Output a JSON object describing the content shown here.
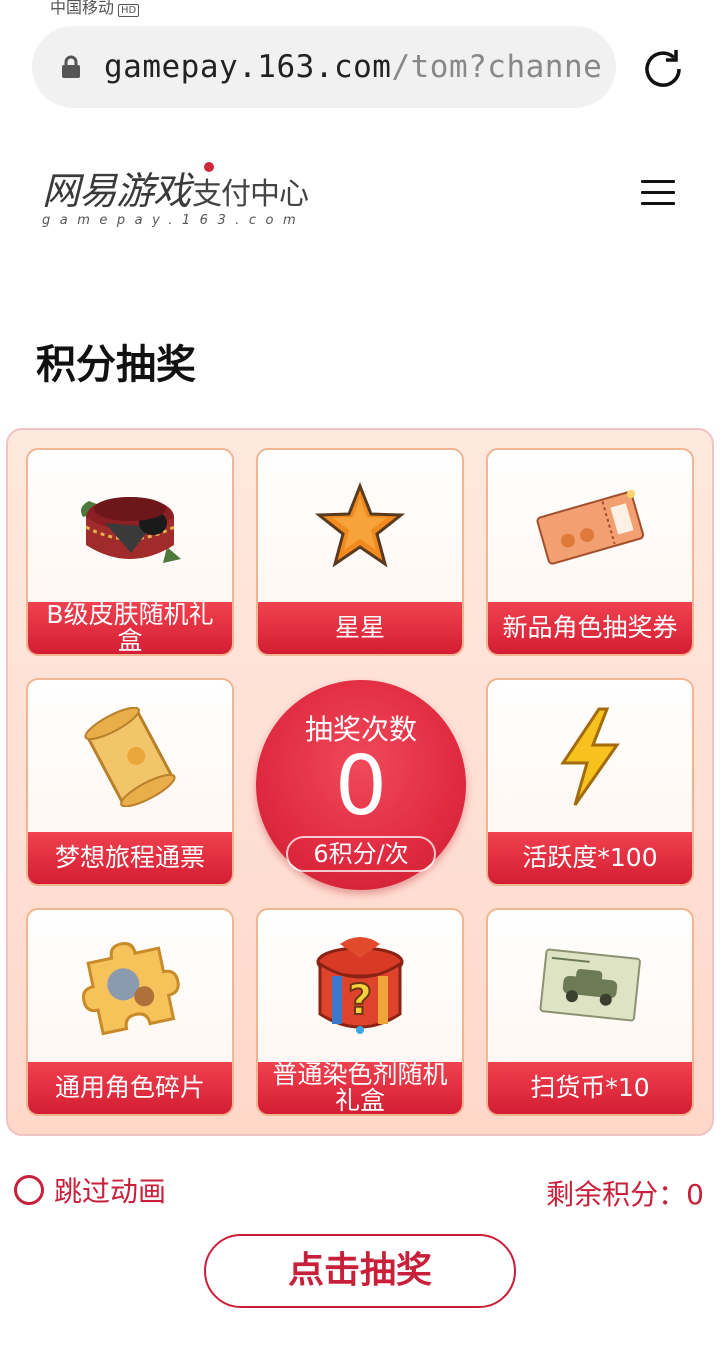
{
  "status_bar": {
    "carrier": "中国移动",
    "badge": "HD"
  },
  "browser": {
    "url_host": "gamepay.163.com",
    "url_path": "/tom?channe",
    "icons": {
      "lock": "lock-icon",
      "reload": "reload-icon"
    }
  },
  "header": {
    "logo_main": "网易游戏",
    "logo_sub": "支付中心",
    "logo_domain": "gamepay.163.com",
    "menu_icon": "hamburger-menu-icon"
  },
  "page_title": "积分抽奖",
  "prizes": [
    {
      "label": "B级皮肤随机礼盒",
      "icon": "gift-box-icon"
    },
    {
      "label": "星星",
      "icon": "star-icon"
    },
    {
      "label": "新品角色抽奖券",
      "icon": "ticket-icon"
    },
    {
      "label": "梦想旅程通票",
      "icon": "scroll-icon"
    },
    {
      "label": "活跃度*100",
      "icon": "lightning-icon"
    },
    {
      "label": "通用角色碎片",
      "icon": "puzzle-piece-icon"
    },
    {
      "label": "普通染色剂随机礼盒",
      "icon": "mystery-box-icon"
    },
    {
      "label": "扫货币*10",
      "icon": "car-ticket-icon"
    }
  ],
  "center": {
    "title": "抽奖次数",
    "count": "0",
    "cost": "6积分/次"
  },
  "skip_animation": {
    "label": "跳过动画",
    "checked": false
  },
  "remaining_points": "剩余积分：0",
  "draw_button": "点击抽奖",
  "colors": {
    "accent": "#c8203a",
    "label_red": "#e02a3f",
    "board_bg": "#ffdccf"
  }
}
